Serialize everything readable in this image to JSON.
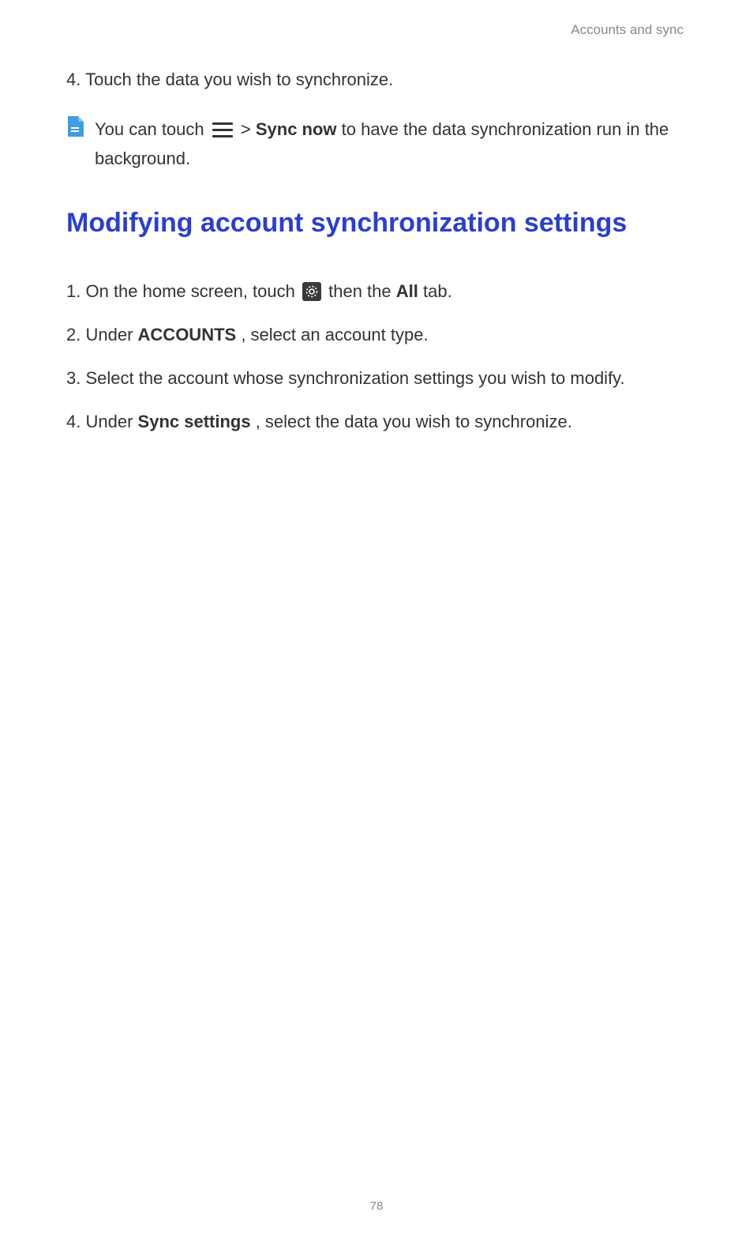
{
  "header": {
    "section_title": "Accounts and sync"
  },
  "intro_step": {
    "number": "4.",
    "text": "Touch the data you wish to synchronize."
  },
  "note": {
    "before_icon": "You can touch ",
    "chevron": " > ",
    "bold_label": "Sync now",
    "after_bold": " to have the data synchronization run in the background."
  },
  "heading": "Modifying account synchronization settings",
  "steps": [
    {
      "number": "1.",
      "before_icon": "On the home screen, touch ",
      "after_icon": " then the ",
      "bold_word": "All",
      "after_bold": " tab."
    },
    {
      "number": "2.",
      "before_bold": "Under ",
      "bold_word": "ACCOUNTS",
      "after_bold": ", select an account type."
    },
    {
      "number": "3.",
      "text": "Select the account whose synchronization settings you wish to modify."
    },
    {
      "number": "4.",
      "before_bold": "Under ",
      "bold_word": "Sync settings",
      "after_bold": ", select the data you wish to synchronize."
    }
  ],
  "page_number": "78"
}
